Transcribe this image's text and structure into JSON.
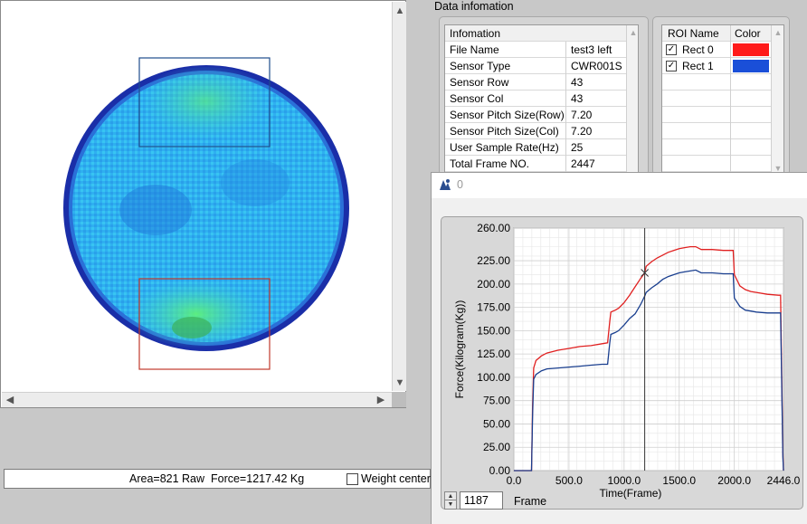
{
  "status": {
    "text": "Area=821 Raw  Force=1217.42 Kg",
    "weight_center_label": "Weight center",
    "weight_center_checked": false
  },
  "data_info": {
    "group_title": "Data infomation",
    "table_header": "Infomation",
    "rows": [
      {
        "key": "File Name",
        "value": "test3 left"
      },
      {
        "key": "Sensor Type",
        "value": "CWR001S"
      },
      {
        "key": "Sensor Row",
        "value": "43"
      },
      {
        "key": "Sensor Col",
        "value": "43"
      },
      {
        "key": "Sensor Pitch Size(Row)",
        "value": "7.20"
      },
      {
        "key": "Sensor Pitch Size(Col)",
        "value": "7.20"
      },
      {
        "key": "User Sample Rate(Hz)",
        "value": "25"
      },
      {
        "key": "Total Frame NO.",
        "value": "2447"
      }
    ]
  },
  "roi": {
    "header_name": "ROI Name",
    "header_color": "Color",
    "items": [
      {
        "name": "Rect 0",
        "checked": true,
        "color": "#ff1a1a"
      },
      {
        "name": "Rect 1",
        "checked": true,
        "color": "#1a4fd8"
      }
    ]
  },
  "chart_window": {
    "title": "0",
    "frame_value": "1187",
    "frame_label": "Frame"
  },
  "colors": {
    "rect0": "#c0392b",
    "rect1": "#1f4e8c",
    "series_red": "#e02020",
    "series_blue": "#1a3f8f"
  },
  "chart_data": {
    "type": "line",
    "xlabel": "Time(Frame)",
    "ylabel": "Force(Kilogram(Kg))",
    "xlim": [
      0,
      2446
    ],
    "ylim": [
      0,
      260
    ],
    "x_ticks": [
      "0.0",
      "500.0",
      "1000.0",
      "1500.0",
      "2000.0",
      "2446.0"
    ],
    "x_tick_values": [
      0,
      500,
      1000,
      1500,
      2000,
      2446
    ],
    "y_ticks": [
      "0.00",
      "25.00",
      "50.00",
      "75.00",
      "100.00",
      "125.00",
      "150.00",
      "175.00",
      "200.00",
      "225.00",
      "260.00"
    ],
    "y_tick_values": [
      0,
      25,
      50,
      75,
      100,
      125,
      150,
      175,
      200,
      225,
      260
    ],
    "grid": true,
    "cursor_x": 1187,
    "series": [
      {
        "color": "#e02020",
        "x": [
          0,
          160,
          170,
          180,
          200,
          250,
          300,
          400,
          500,
          600,
          700,
          800,
          850,
          870,
          880,
          920,
          950,
          1000,
          1050,
          1100,
          1150,
          1187,
          1200,
          1250,
          1300,
          1350,
          1400,
          1450,
          1500,
          1550,
          1600,
          1650,
          1700,
          1800,
          1900,
          1990,
          2000,
          2050,
          2100,
          2150,
          2200,
          2300,
          2400,
          2420,
          2440,
          2446
        ],
        "y": [
          0,
          0,
          70,
          110,
          118,
          123,
          126,
          129,
          131,
          133,
          134,
          136,
          137,
          160,
          170,
          172,
          174,
          180,
          188,
          197,
          206,
          212,
          219,
          224,
          228,
          231,
          234,
          236,
          238,
          239,
          240,
          240,
          237,
          237,
          236,
          236,
          210,
          198,
          194,
          192,
          191,
          189,
          188,
          188,
          20,
          0
        ]
      },
      {
        "color": "#1a3f8f",
        "x": [
          0,
          160,
          170,
          180,
          200,
          250,
          300,
          400,
          500,
          600,
          700,
          800,
          850,
          870,
          880,
          920,
          950,
          1000,
          1050,
          1100,
          1150,
          1187,
          1200,
          1250,
          1300,
          1350,
          1400,
          1450,
          1500,
          1550,
          1600,
          1650,
          1700,
          1800,
          1900,
          1990,
          2000,
          2050,
          2100,
          2150,
          2200,
          2300,
          2400,
          2420,
          2440,
          2446
        ],
        "y": [
          0,
          0,
          60,
          98,
          103,
          107,
          109,
          110,
          111,
          112,
          113,
          114,
          114,
          137,
          146,
          148,
          150,
          156,
          163,
          168,
          178,
          187,
          191,
          196,
          200,
          205,
          208,
          210,
          212,
          213,
          214,
          215,
          212,
          212,
          211,
          211,
          185,
          176,
          172,
          171,
          170,
          169,
          169,
          169,
          15,
          0
        ]
      }
    ]
  }
}
